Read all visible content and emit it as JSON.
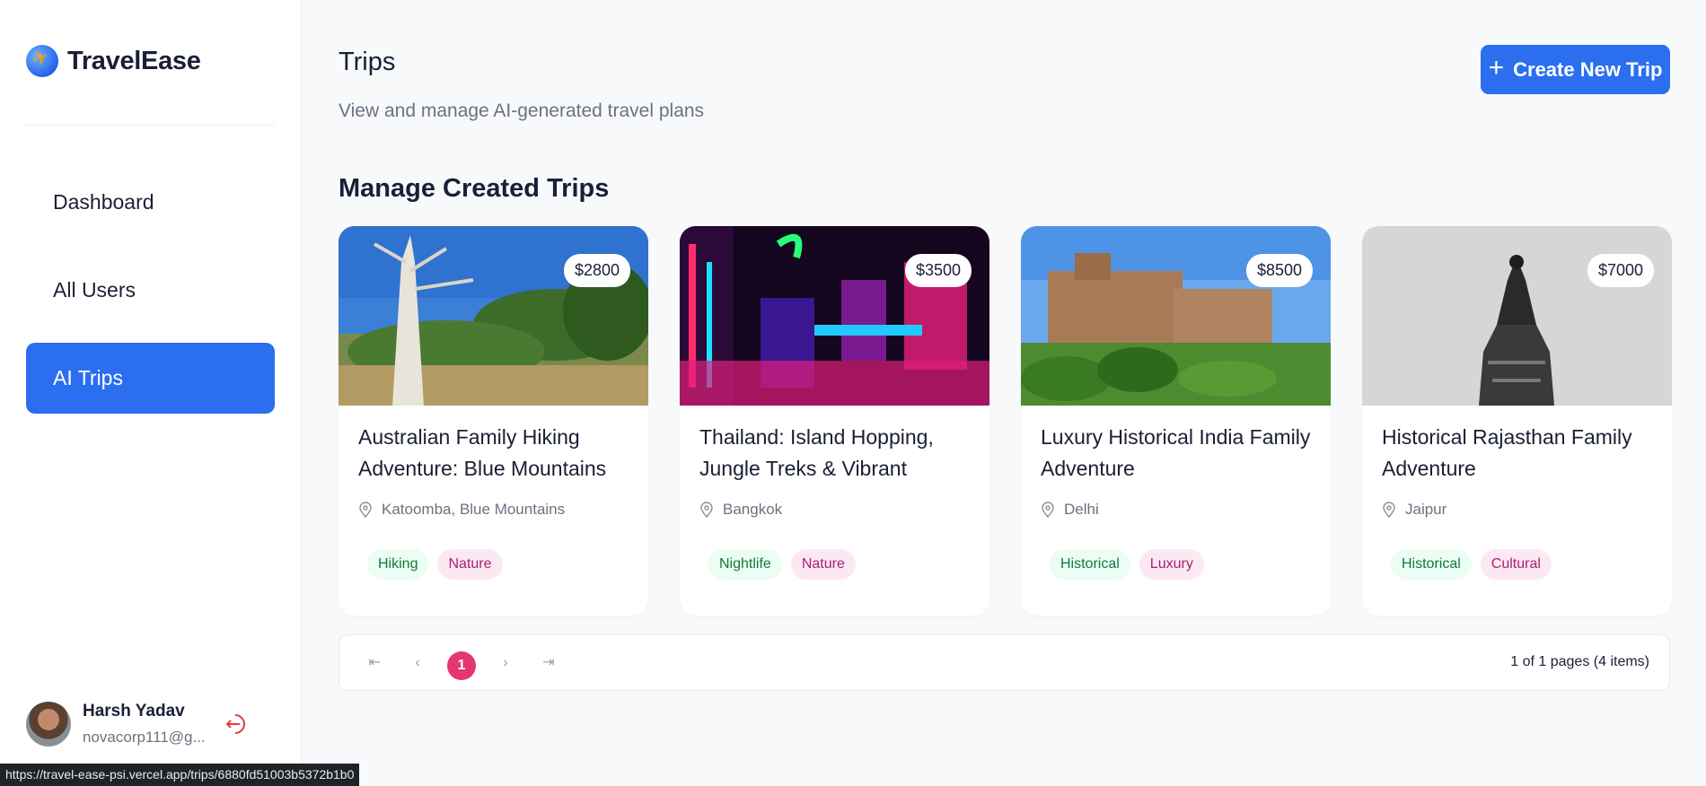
{
  "brand": {
    "name": "TravelEase"
  },
  "nav": [
    {
      "label": "Dashboard"
    },
    {
      "label": "All Users"
    },
    {
      "label": "AI Trips"
    }
  ],
  "user": {
    "name": "Harsh Yadav",
    "email": "novacorp111@g..."
  },
  "header": {
    "title": "Trips",
    "subtitle": "View and manage AI-generated travel plans",
    "create_label": "Create New Trip"
  },
  "section": {
    "title": "Manage Created Trips"
  },
  "trips": [
    {
      "price": "$2800",
      "title": "Australian Family Hiking Adventure: Blue Mountains ...",
      "location": "Katoomba, Blue Mountains",
      "tags": [
        "Hiking",
        "Nature"
      ]
    },
    {
      "price": "$3500",
      "title": "Thailand: Island Hopping, Jungle Treks & Vibrant Nights",
      "location": "Bangkok",
      "tags": [
        "Nightlife",
        "Nature"
      ]
    },
    {
      "price": "$8500",
      "title": "Luxury Historical India Family Adventure",
      "location": "Delhi",
      "tags": [
        "Historical",
        "Luxury"
      ]
    },
    {
      "price": "$7000",
      "title": "Historical Rajasthan Family Adventure",
      "location": "Jaipur",
      "tags": [
        "Historical",
        "Cultural"
      ]
    }
  ],
  "pagination": {
    "current": "1",
    "info": "1 of 1 pages (4 items)"
  },
  "status_url": "https://travel-ease-psi.vercel.app/trips/6880fd51003b5372b1b0",
  "colors": {
    "accent": "#2b6ef0",
    "page_active": "#e33672"
  }
}
